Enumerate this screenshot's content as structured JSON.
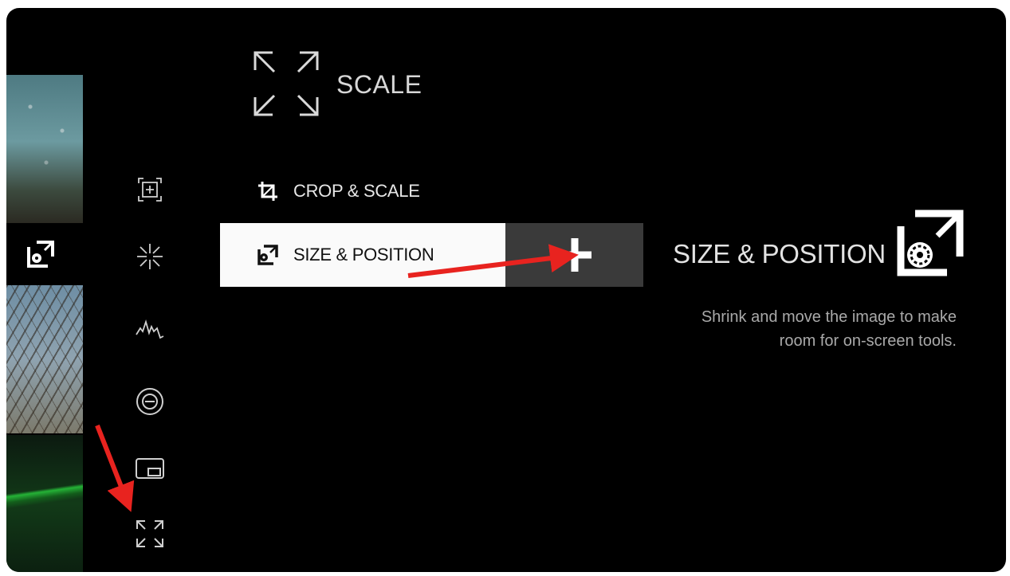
{
  "header": {
    "title": "SCALE",
    "icon": "scale-arrows-icon"
  },
  "sidebar": {
    "icons": [
      "focus-assist-icon",
      "aperture-icon",
      "waveform-icon",
      "exposure-icon",
      "picture-in-picture-icon",
      "scale-arrows-icon"
    ],
    "active_thumbnail_icon": "size-position-icon"
  },
  "menu": {
    "items": [
      {
        "label": "CROP & SCALE",
        "icon": "crop-icon",
        "selected": false
      },
      {
        "label": "SIZE & POSITION",
        "icon": "size-position-icon",
        "selected": true
      }
    ],
    "add_button_icon": "plus-icon"
  },
  "detail": {
    "title": "SIZE & POSITION",
    "icon": "size-position-icon",
    "description": "Shrink and move the image to make room for on-screen tools."
  },
  "annotations": {
    "arrow_color": "#e8231f"
  },
  "colors": {
    "background": "#000000",
    "selected_row": "#fafafa",
    "plus_button": "#3a3a3a"
  }
}
